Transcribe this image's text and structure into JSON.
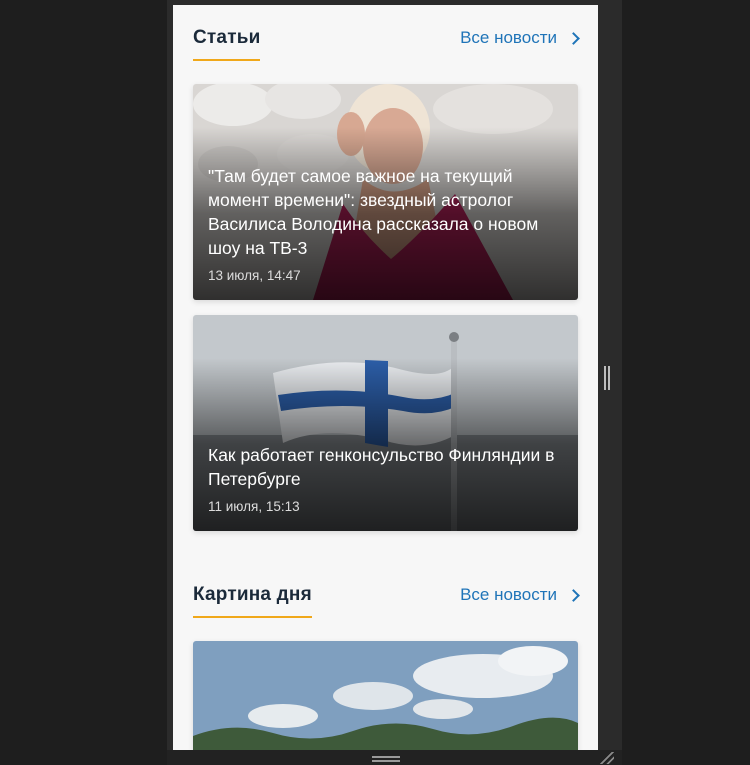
{
  "sections": [
    {
      "title": "Статьи",
      "all_link": "Все новости",
      "cards": [
        {
          "title": "\"Там будет самое важное на текущий момент времени\": звездный астролог Василиса Володина рассказала о новом шоу на ТВ-3",
          "date": "13 июля, 14:47"
        },
        {
          "title": "Как работает генконсульство Финляндии в Петербурге",
          "date": "11 июля, 15:13"
        }
      ]
    },
    {
      "title": "Картина дня",
      "all_link": "Все новости"
    }
  ],
  "colors": {
    "accent_underline": "#f0a81a",
    "link": "#1f74b8",
    "title": "#1b2a3a"
  },
  "icons": {
    "all_link_icon": "chevron-right-icon",
    "window_resize": "resize-grip-icon",
    "scroll_handle": "scroll-handle-icon"
  }
}
